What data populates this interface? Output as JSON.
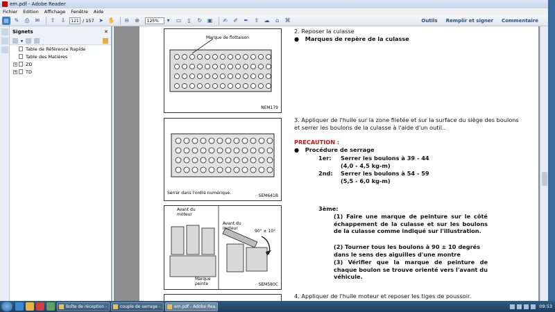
{
  "window": {
    "title": "em.pdf - Adobe Reader"
  },
  "menu": [
    "Fichier",
    "Edition",
    "Affichage",
    "Fenêtre",
    "Aide"
  ],
  "toolbar": {
    "page_current": "121",
    "page_total": "/ 157",
    "zoom": "125%",
    "right_buttons": [
      "Outils",
      "Remplir et signer",
      "Commentaire"
    ]
  },
  "nav": {
    "title": "Signets",
    "options_glyph": "▾",
    "close_glyph": "✕",
    "bookmarks": [
      {
        "label": "Table de Référence Rapide",
        "expandable": false
      },
      {
        "label": "Table des Matières",
        "expandable": false
      },
      {
        "label": "ZD",
        "expandable": true
      },
      {
        "label": "TD",
        "expandable": true
      }
    ]
  },
  "figures": [
    {
      "label": "Marque de flottaison",
      "code": "NEM179"
    },
    {
      "label": "Serrer dans l'ordre numérique.",
      "code": "SEM641B"
    },
    {
      "label_front1": "Avant du moteur",
      "label_front2": "Avant du moteur",
      "label_angle": "90° ± 10°",
      "label_mark": "Marque peinte",
      "code": "SEM580C"
    }
  ],
  "content": {
    "step2": "2.   Reposer la culasse",
    "bullet1": "Marques de repère de la culasse",
    "step3": "3.   Appliquer de l'huile sur la zone filetée et sur la surface du siège des boulons et serrer les boulons de la culasse à l'aide d'un outil..",
    "precaution": "PRECAUTION :",
    "bullet2": "Procédure de serrage",
    "s1_label": "1er:",
    "s1_text": "Serrer les boulons à 39 - 44",
    "s1_sub": "(4,0 - 4,5 kg-m)",
    "s2_label": "2nd:",
    "s2_text": "Serrer les boulons à 54 - 59",
    "s2_sub": "(5,5 - 6,0 kg-m)",
    "s3_label": "3ème:",
    "s3_1": "(1)  Faire une marque de peinture sur le côté échappement de la culasse et sur les boulons de la culasse comme indiqué sur l'illustration.",
    "s3_2": "(2)  Tourner tous les boulons à 90 ± 10 degrés dans le sens des aiguilles d'une montre",
    "s3_3": "(3)  Vérifier que la marque de peinture de chaque boulon se trouve orienté vers l'avant du véhicule.",
    "step4": "4.   Appliquer de l'huile moteur et reposer les tiges de poussoir."
  },
  "taskbar": {
    "tasks": [
      "Boîte de réception - ...",
      "couple de serrage - ...",
      "em.pdf - Adobe Rea..."
    ],
    "clock": "09:53"
  }
}
